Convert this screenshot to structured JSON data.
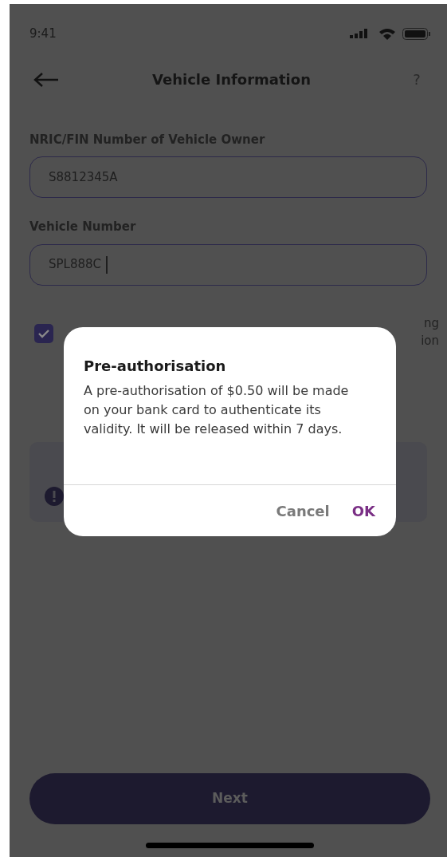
{
  "status_bar": {
    "time": "9:41"
  },
  "header": {
    "title": "Vehicle Information",
    "help": "?"
  },
  "fields": [
    {
      "label": "NRIC/FIN Number of Vehicle Owner",
      "value": "S8812345A",
      "focused": false
    },
    {
      "label": "Vehicle Number",
      "value": "SPL888C",
      "focused": true
    }
  ],
  "consent": {
    "checked": true,
    "label_lines": [
      "ng",
      "ion"
    ]
  },
  "dialog": {
    "title": "Pre-authorisation",
    "message": "A pre-authorisation of $0.50 will be made on your bank card to authenticate its validity. It will be released within 7 days.",
    "buttons": [
      {
        "label": "Cancel",
        "kind": "secondary"
      },
      {
        "label": "OK",
        "kind": "primary"
      }
    ]
  },
  "next_button": {
    "label": "Next",
    "disabled": true
  }
}
